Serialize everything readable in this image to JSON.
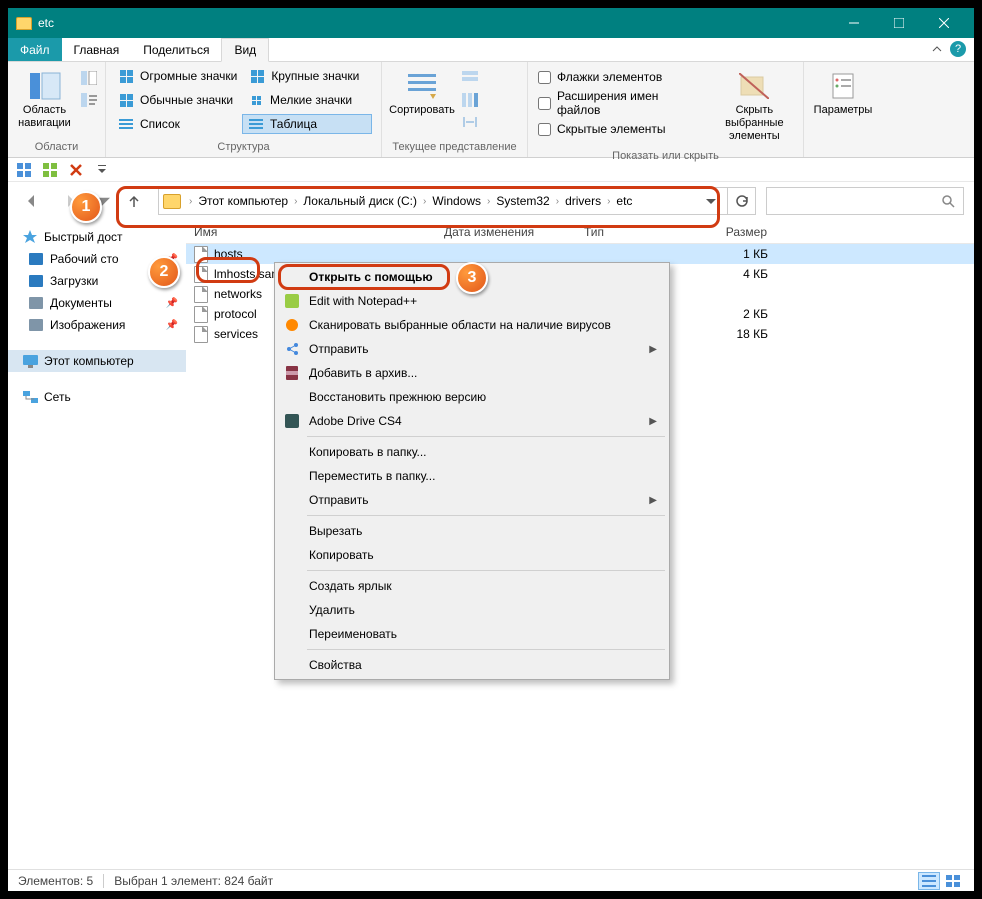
{
  "window": {
    "title": "etc"
  },
  "tabs": {
    "file": "Файл",
    "main": "Главная",
    "share": "Поделиться",
    "view": "Вид"
  },
  "ribbon": {
    "panes": {
      "label": "Области",
      "navpane": "Область навигации"
    },
    "layout": {
      "label": "Структура",
      "huge": "Огромные значки",
      "large": "Крупные значки",
      "normal": "Обычные значки",
      "small": "Мелкие значки",
      "list": "Список",
      "table": "Таблица"
    },
    "view": {
      "label": "Текущее представление",
      "sort": "Сортировать"
    },
    "show": {
      "label": "Показать или скрыть",
      "chk1": "Флажки элементов",
      "chk2": "Расширения имен файлов",
      "chk3": "Скрытые элементы",
      "hidebtn": "Скрыть выбранные элементы"
    },
    "options": "Параметры"
  },
  "breadcrumb": {
    "parts": [
      "Этот компьютер",
      "Локальный диск (C:)",
      "Windows",
      "System32",
      "drivers",
      "etc"
    ]
  },
  "search": {
    "placeholder": ""
  },
  "columns": {
    "name": "Имя",
    "date": "Дата изменения",
    "type": "Тип",
    "size": "Размер"
  },
  "colw": {
    "name": 250,
    "date": 140,
    "type": 110,
    "size": 90
  },
  "files": [
    {
      "name": "hosts",
      "size": "1 КБ",
      "selected": true
    },
    {
      "name": "lmhosts.sam",
      "size": "4 КБ"
    },
    {
      "name": "networks",
      "size": ""
    },
    {
      "name": "protocol",
      "size": "2 КБ"
    },
    {
      "name": "services",
      "size": "18 КБ"
    }
  ],
  "sidebar": {
    "quick": "Быстрый дост",
    "items": [
      {
        "label": "Рабочий сто",
        "color": "#2a7abf"
      },
      {
        "label": "Загрузки",
        "color": "#2a7abf"
      },
      {
        "label": "Документы",
        "color": "#7f95a8"
      },
      {
        "label": "Изображения",
        "color": "#7f95a8"
      }
    ],
    "thispc": "Этот компьютер",
    "network": "Сеть"
  },
  "context": [
    {
      "label": "Открыть с помощью",
      "bold": true,
      "hl": true
    },
    {
      "label": "Edit with Notepad++",
      "icon": "np"
    },
    {
      "label": "Сканировать выбранные области на наличие вирусов",
      "icon": "av"
    },
    {
      "label": "Отправить",
      "icon": "sh",
      "arrow": true
    },
    {
      "label": "Добавить в архив...",
      "icon": "rar"
    },
    {
      "label": "Восстановить прежнюю версию"
    },
    {
      "label": "Adobe Drive CS4",
      "icon": "ad",
      "arrow": true
    },
    {
      "sep": true
    },
    {
      "label": "Копировать в папку..."
    },
    {
      "label": "Переместить в папку..."
    },
    {
      "label": "Отправить",
      "arrow": true
    },
    {
      "sep": true
    },
    {
      "label": "Вырезать"
    },
    {
      "label": "Копировать"
    },
    {
      "sep": true
    },
    {
      "label": "Создать ярлык"
    },
    {
      "label": "Удалить"
    },
    {
      "label": "Переименовать"
    },
    {
      "sep": true
    },
    {
      "label": "Свойства"
    }
  ],
  "status": {
    "count": "Элементов: 5",
    "sel": "Выбран 1 элемент: 824 байт"
  },
  "badges": {
    "b1": "1",
    "b2": "2",
    "b3": "3"
  }
}
